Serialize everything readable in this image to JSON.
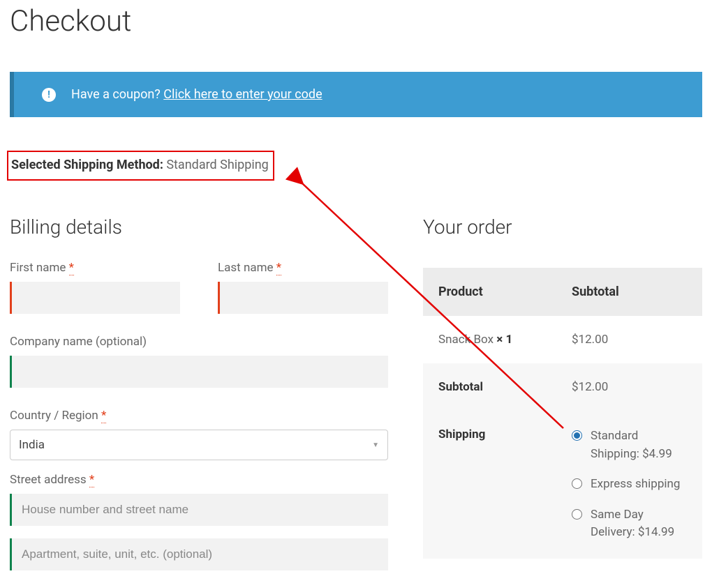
{
  "page": {
    "title": "Checkout"
  },
  "coupon": {
    "question": "Have a coupon?",
    "link_text": "Click here to enter your code"
  },
  "selected_shipping": {
    "label": "Selected Shipping Method:",
    "value": "Standard Shipping"
  },
  "billing": {
    "heading": "Billing details",
    "first_name_label": "First name",
    "last_name_label": "Last name",
    "company_label": "Company name",
    "company_optional": "(optional)",
    "country_label": "Country / Region",
    "country_value": "India",
    "street_label": "Street address",
    "street_placeholder1": "House number and street name",
    "street_placeholder2": "Apartment, suite, unit, etc. (optional)",
    "required_mark": "*"
  },
  "order": {
    "heading": "Your order",
    "th_product": "Product",
    "th_subtotal": "Subtotal",
    "item_name": "Snack Box ",
    "item_qty": "× 1",
    "item_price": "$12.00",
    "subtotal_label": "Subtotal",
    "subtotal_value": "$12.00",
    "shipping_label": "Shipping",
    "ship_opts": [
      {
        "label": "Standard Shipping:",
        "price": "$4.99",
        "checked": true
      },
      {
        "label": "Express shipping",
        "price": "",
        "checked": false
      },
      {
        "label": "Same Day Delivery:",
        "price": "$14.99",
        "checked": false
      }
    ]
  }
}
